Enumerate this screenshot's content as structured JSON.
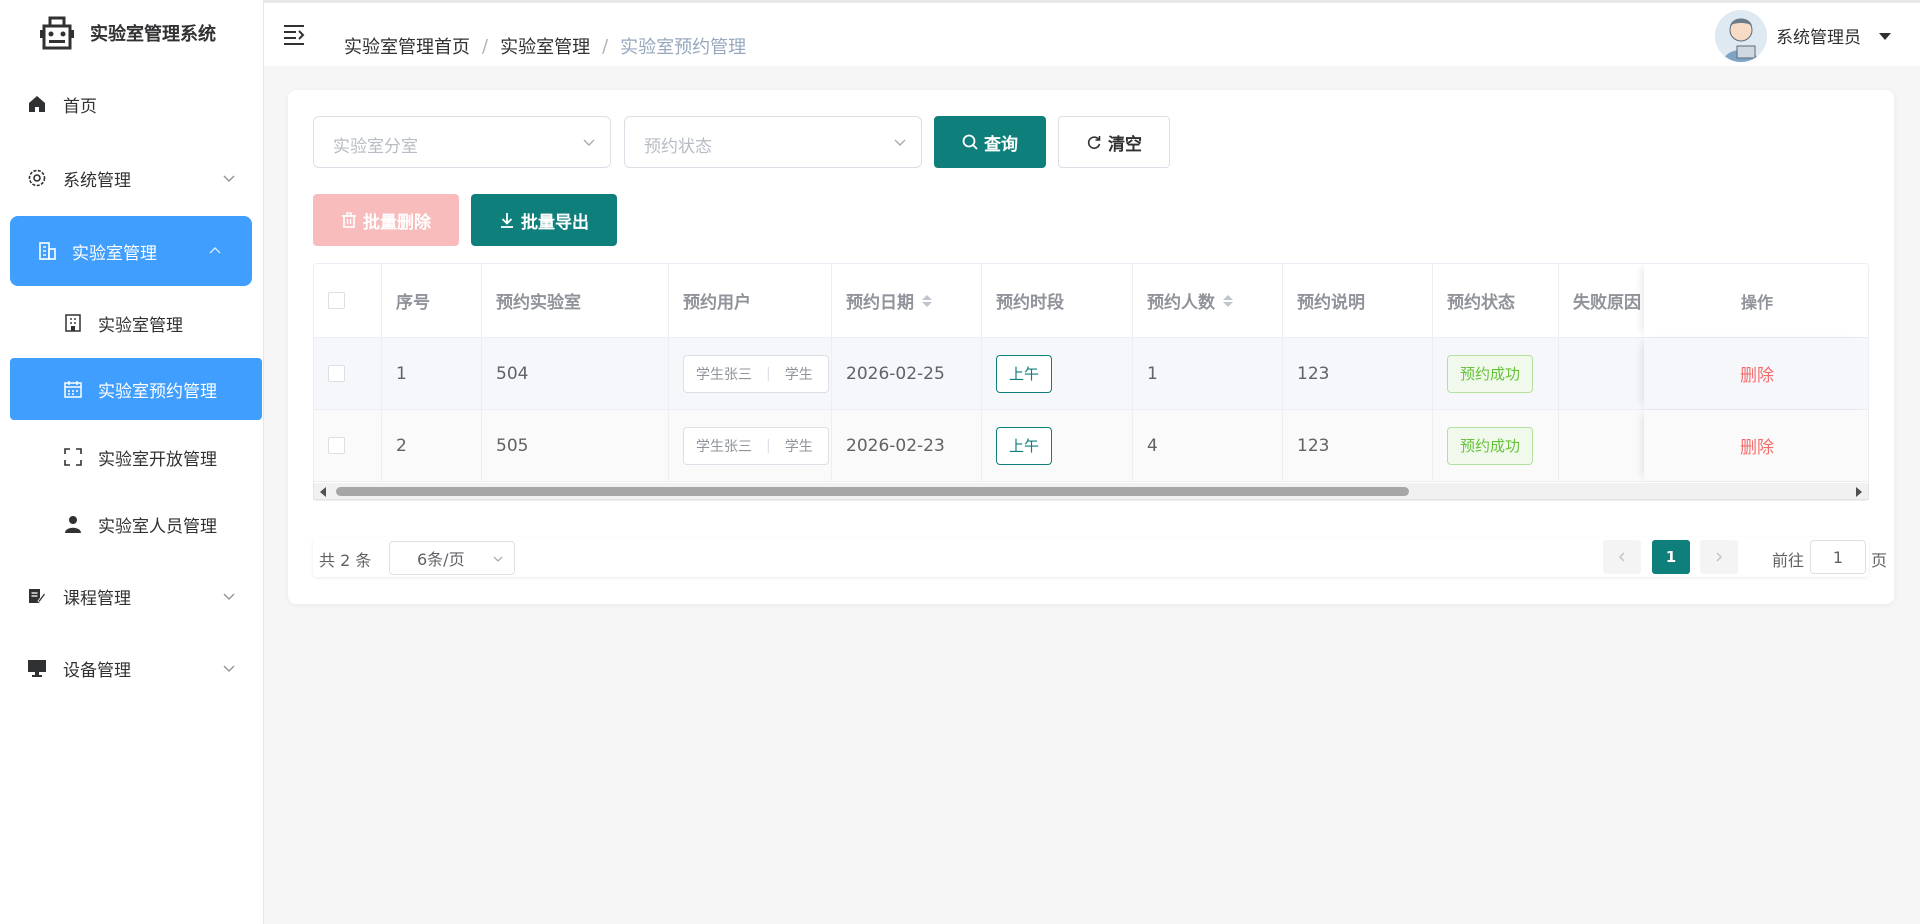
{
  "app": {
    "title": "实验室管理系统"
  },
  "sidebar": {
    "items": [
      {
        "label": "首页",
        "icon": "home-icon"
      },
      {
        "label": "系统管理",
        "icon": "gear-icon"
      },
      {
        "label": "实验室管理",
        "icon": "building-icon"
      },
      {
        "label": "课程管理",
        "icon": "course-icon"
      },
      {
        "label": "设备管理",
        "icon": "monitor-icon"
      }
    ],
    "subitems": [
      {
        "label": "实验室管理",
        "icon": "office-icon"
      },
      {
        "label": "实验室预约管理",
        "icon": "calendar-icon"
      },
      {
        "label": "实验室开放管理",
        "icon": "scan-frame-icon"
      },
      {
        "label": "实验室人员管理",
        "icon": "user-icon"
      }
    ]
  },
  "header": {
    "breadcrumb": [
      "实验室管理首页",
      "实验室管理",
      "实验室预约管理"
    ],
    "separator": "/",
    "user": "系统管理员"
  },
  "filters": {
    "room_placeholder": "实验室分室",
    "status_placeholder": "预约状态",
    "query_label": "查询",
    "clear_label": "清空"
  },
  "actions": {
    "batch_delete": "批量删除",
    "batch_export": "批量导出"
  },
  "table": {
    "columns": [
      "序号",
      "预约实验室",
      "预约用户",
      "预约日期",
      "预约时段",
      "预约人数",
      "预约说明",
      "预约状态",
      "失败原因",
      "操作"
    ],
    "rows": [
      {
        "index": "1",
        "lab": "504",
        "users": [
          "学生张三",
          "学生"
        ],
        "date": "2026-02-25",
        "slot": "上午",
        "count": "1",
        "note": "123",
        "status": "预约成功",
        "reason": "",
        "action": "删除"
      },
      {
        "index": "2",
        "lab": "505",
        "users": [
          "学生张三",
          "学生"
        ],
        "date": "2026-02-23",
        "slot": "上午",
        "count": "4",
        "note": "123",
        "status": "预约成功",
        "reason": "",
        "action": "删除"
      }
    ]
  },
  "pagination": {
    "total": "共 2 条",
    "page_size": "6条/页",
    "current_page": "1",
    "goto_label": "前往",
    "goto_value": "1",
    "page_unit": "页"
  },
  "colors": {
    "primary": "#0f7f7c",
    "active_menu": "#409eff",
    "danger": "#f56c6c",
    "success": "#67c23a"
  }
}
